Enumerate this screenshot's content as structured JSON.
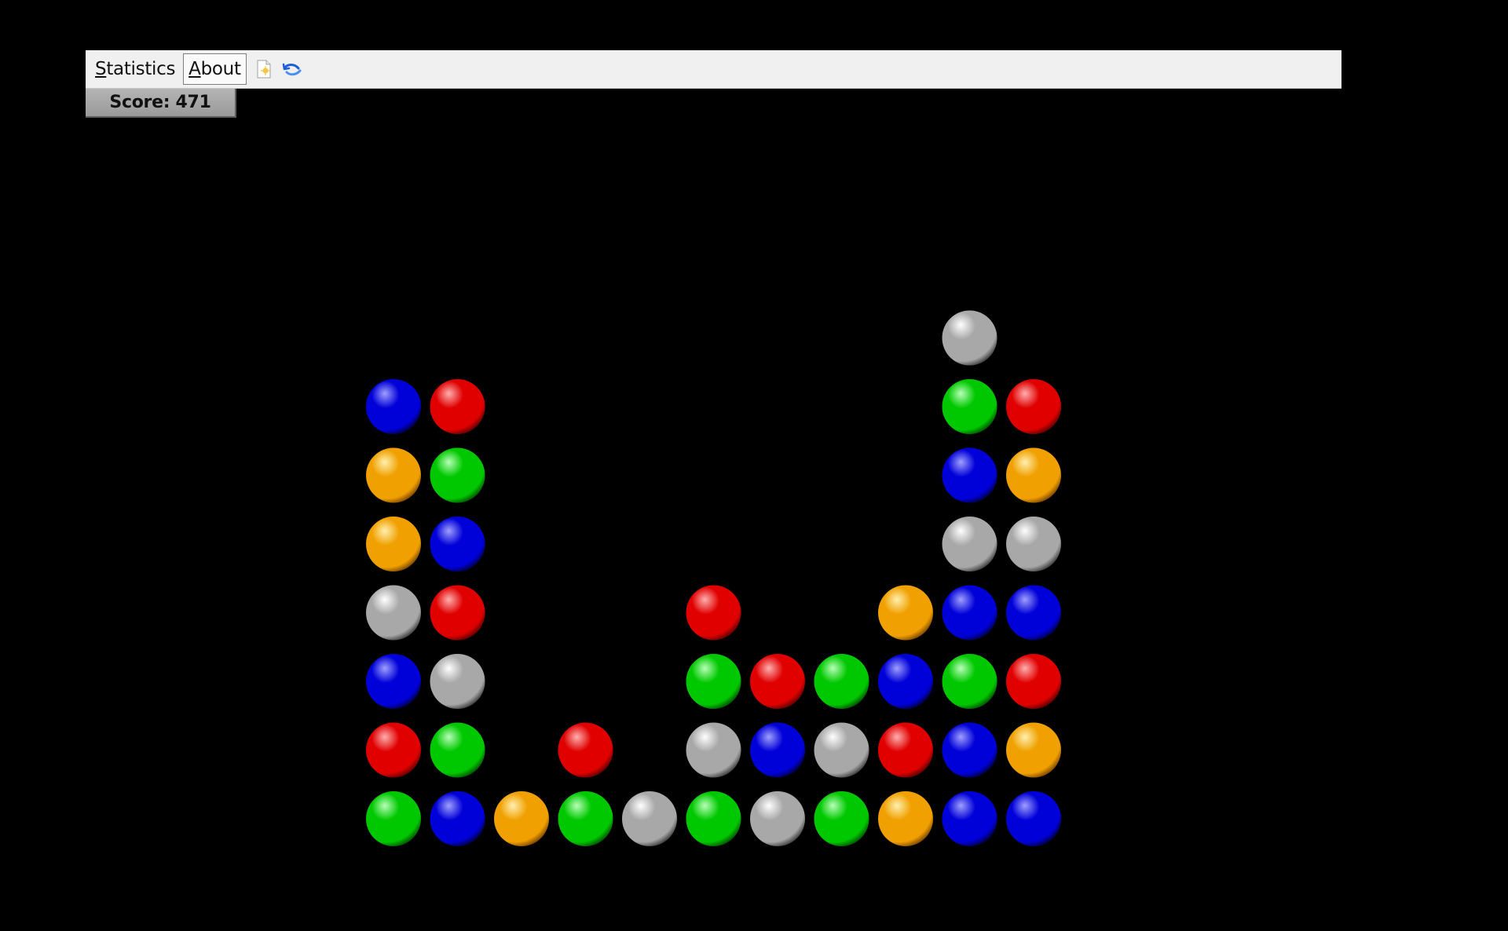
{
  "menu": {
    "statistics": {
      "accel": "S",
      "rest": "tatistics"
    },
    "about": {
      "accel": "A",
      "rest": "bout"
    }
  },
  "toolbar_icons": [
    "new-game-icon",
    "undo-icon"
  ],
  "score": {
    "label": "Score: 471",
    "value": 471
  },
  "board": {
    "columns": 11,
    "rows": 8,
    "colors": {
      "red": "#e00000",
      "green": "#00c800",
      "blue": "#0000d8",
      "orange": "#f0a000",
      "gray": "#a8a8a8"
    },
    "stacks": [
      [
        "green",
        "red",
        "blue",
        "gray",
        "orange",
        "orange",
        "blue"
      ],
      [
        "blue",
        "green",
        "gray",
        "red",
        "blue",
        "green",
        "red"
      ],
      [
        "orange"
      ],
      [
        "green",
        "red"
      ],
      [
        "gray"
      ],
      [
        "green",
        "gray",
        "green",
        "red"
      ],
      [
        "gray",
        "blue",
        "red"
      ],
      [
        "green",
        "gray",
        "green"
      ],
      [
        "orange",
        "red",
        "blue",
        "orange"
      ],
      [
        "blue",
        "blue",
        "green",
        "blue",
        "gray",
        "blue",
        "green",
        "gray"
      ],
      [
        "blue",
        "orange",
        "red",
        "blue",
        "gray",
        "orange",
        "red"
      ]
    ]
  }
}
